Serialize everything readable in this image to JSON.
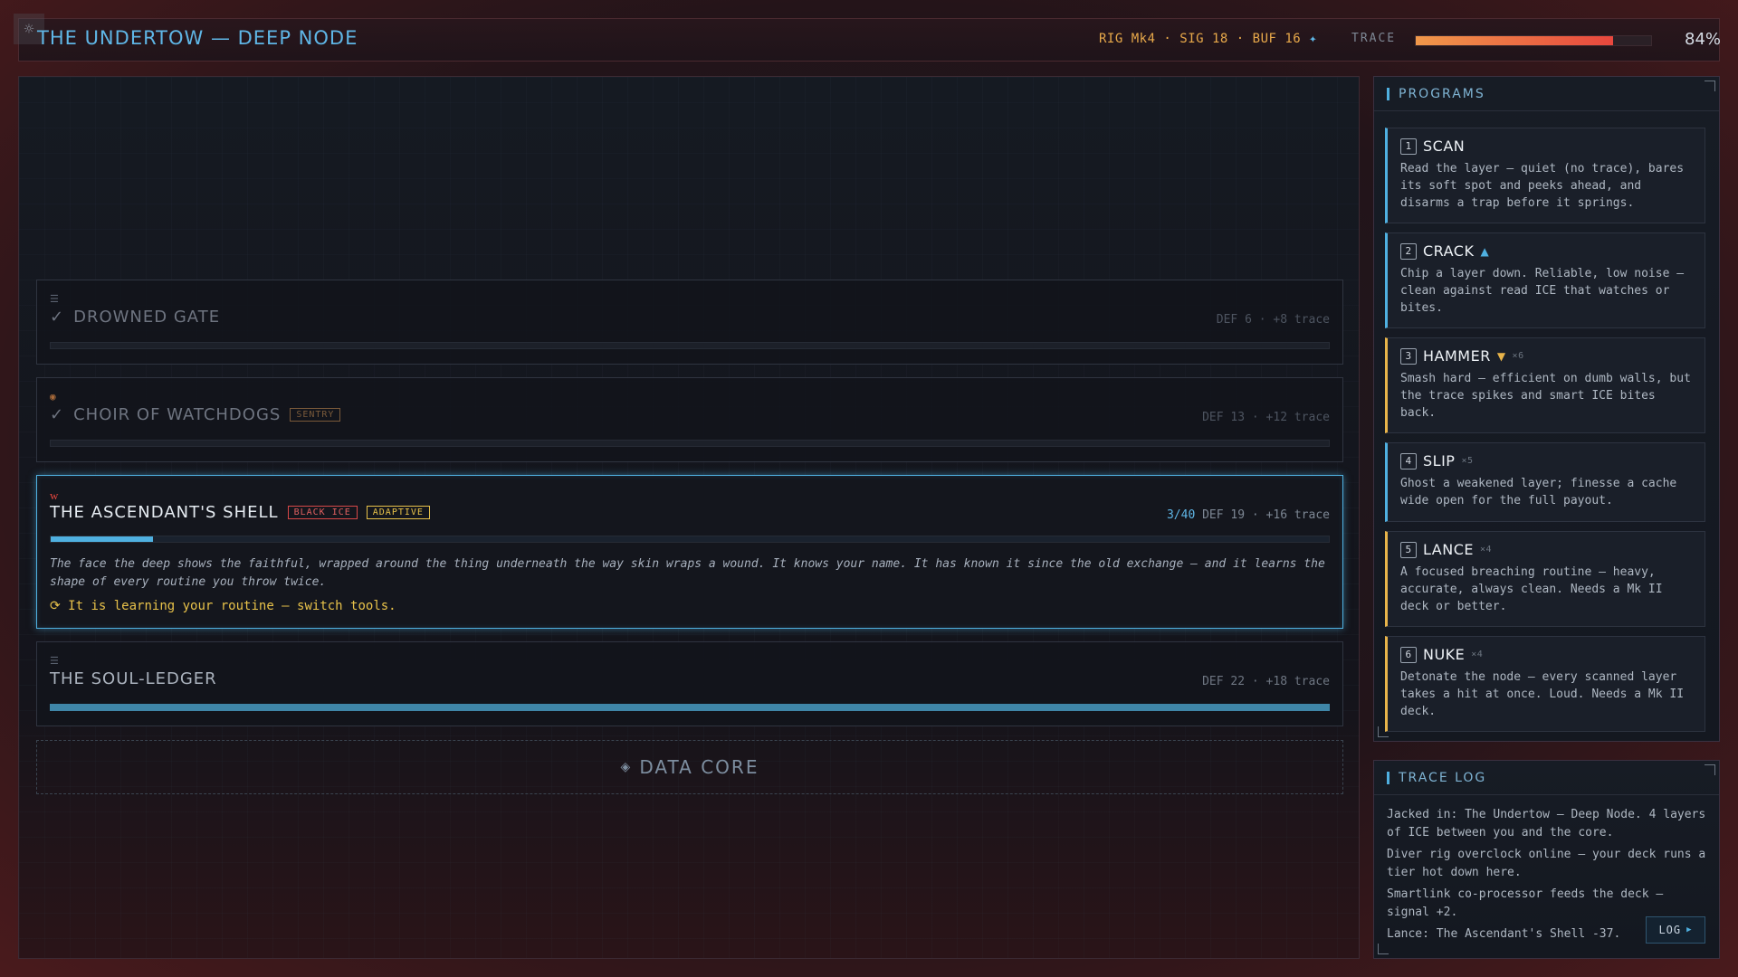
{
  "header": {
    "title": "THE UNDERTOW — DEEP NODE",
    "rig": "RIG Mk4 · SIG 18 · BUF 16",
    "rig_icon": "diamond-icon",
    "trace_label": "TRACE",
    "trace_percent": "84%",
    "trace_value": 0.84
  },
  "layers": {
    "drowned_gate": {
      "name": "DROWNED GATE",
      "check": "✓",
      "stats": "DEF 6 · +8 trace"
    },
    "choir": {
      "name": "CHOIR OF WATCHDOGS",
      "check": "✓",
      "tag": "SENTRY",
      "stats": "DEF 13 · +12 trace"
    },
    "ascendant": {
      "name": "THE ASCENDANT'S SHELL",
      "tag_black": "BLACK ICE",
      "tag_adaptive": "ADAPTIVE",
      "progress": "3/40",
      "stats": "DEF 19 · +16 trace",
      "progress_value": 0.08,
      "flavor": "The face the deep shows the faithful, wrapped around the thing underneath the way skin wraps a wound. It knows your name. It has known it since the old exchange — and it learns the shape of every routine you throw twice.",
      "warning": "It is learning your routine — switch tools."
    },
    "soul_ledger": {
      "name": "THE SOUL-LEDGER",
      "stats": "DEF 22 · +18 trace",
      "progress_value": 1.0
    }
  },
  "core": {
    "label": "DATA CORE"
  },
  "programs_panel": {
    "title": "PROGRAMS",
    "items": [
      {
        "key": "1",
        "name": "SCAN",
        "marker": "",
        "count": "",
        "desc": "Read the layer — quiet (no trace), bares its soft spot and peeks ahead, and disarms a trap before it springs."
      },
      {
        "key": "2",
        "name": "CRACK",
        "marker": "▲",
        "count": "",
        "desc": "Chip a layer down. Reliable, low noise — clean against read ICE that watches or bites."
      },
      {
        "key": "3",
        "name": "HAMMER",
        "marker": "▼",
        "count": "×6",
        "desc": "Smash hard — efficient on dumb walls, but the trace spikes and smart ICE bites back."
      },
      {
        "key": "4",
        "name": "SLIP",
        "marker": "",
        "count": "×5",
        "desc": "Ghost a weakened layer; finesse a cache wide open for the full payout."
      },
      {
        "key": "5",
        "name": "LANCE",
        "marker": "",
        "count": "×4",
        "desc": "A focused breaching routine — heavy, accurate, always clean. Needs a Mk II deck or better."
      },
      {
        "key": "6",
        "name": "NUKE",
        "marker": "",
        "count": "×4",
        "desc": "Detonate the node — every scanned layer takes a hit at once. Loud. Needs a Mk II deck."
      }
    ]
  },
  "trace_log": {
    "title": "TRACE LOG",
    "entries": [
      "Jacked in: The Undertow — Deep Node. 4 layers of ICE between you and the core.",
      "Diver rig overclock online — your deck runs a tier hot down here.",
      "Smartlink co-processor feeds the deck — signal +2.",
      "Lance: The Ascendant's Shell -37."
    ],
    "button": "LOG"
  }
}
